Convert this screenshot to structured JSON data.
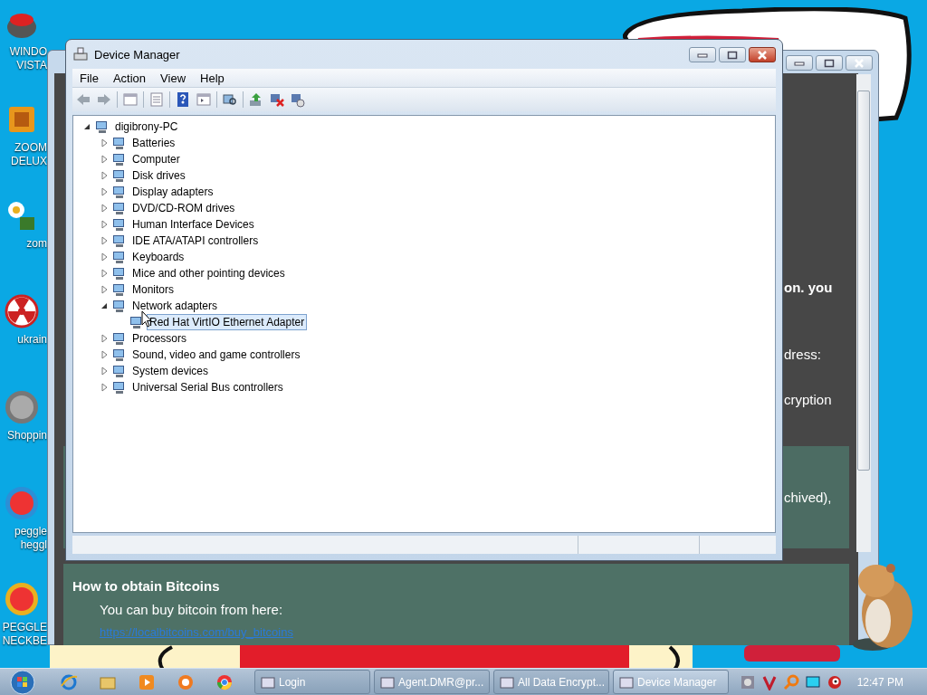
{
  "desktop_icons": [
    {
      "lines": [
        "WINDO",
        "VISTA"
      ]
    },
    {
      "lines": [
        "ZOOM",
        "DELUX"
      ]
    },
    {
      "lines": [
        "zom"
      ]
    },
    {
      "lines": [
        "ukrain"
      ]
    },
    {
      "lines": [
        "Shoppin"
      ]
    },
    {
      "lines": [
        "peggle",
        "heggl"
      ]
    },
    {
      "lines": [
        "PEGGLE",
        "NECKBE"
      ]
    }
  ],
  "background_window": {
    "fragments": [
      {
        "text": "on. you",
        "bold": true
      },
      {
        "text": "dress:",
        "bold": false
      },
      {
        "text": "cryption",
        "bold": false
      }
    ],
    "panel_text": "chived),",
    "bitcoin_section": {
      "heading": "How to obtain Bitcoins",
      "text": "You can buy bitcoin from here:",
      "link": "https://localbitcoins.com/buy_bitcoins"
    }
  },
  "device_manager": {
    "title": "Device Manager",
    "menu": [
      "File",
      "Action",
      "View",
      "Help"
    ],
    "tree": {
      "label": "digibrony-PC",
      "expanded": true,
      "selected": false,
      "children": [
        {
          "label": "Batteries",
          "expanded": false,
          "selected": false
        },
        {
          "label": "Computer",
          "expanded": false,
          "selected": false
        },
        {
          "label": "Disk drives",
          "expanded": false,
          "selected": false
        },
        {
          "label": "Display adapters",
          "expanded": false,
          "selected": false
        },
        {
          "label": "DVD/CD-ROM drives",
          "expanded": false,
          "selected": false
        },
        {
          "label": "Human Interface Devices",
          "expanded": false,
          "selected": false
        },
        {
          "label": "IDE ATA/ATAPI controllers",
          "expanded": false,
          "selected": false
        },
        {
          "label": "Keyboards",
          "expanded": false,
          "selected": false
        },
        {
          "label": "Mice and other pointing devices",
          "expanded": false,
          "selected": false
        },
        {
          "label": "Monitors",
          "expanded": false,
          "selected": false
        },
        {
          "label": "Network adapters",
          "expanded": true,
          "selected": false,
          "children": [
            {
              "label": "Red Hat VirtIO Ethernet Adapter",
              "selected": true
            }
          ]
        },
        {
          "label": "Processors",
          "expanded": false,
          "selected": false
        },
        {
          "label": "Sound, video and game controllers",
          "expanded": false,
          "selected": false
        },
        {
          "label": "System devices",
          "expanded": false,
          "selected": false
        },
        {
          "label": "Universal Serial Bus controllers",
          "expanded": false,
          "selected": false
        }
      ]
    }
  },
  "taskbar": {
    "tasks": [
      {
        "label": "Login",
        "selected": false
      },
      {
        "label": "Agent.DMR@pr...",
        "selected": false
      },
      {
        "label": "All Data Encrypt...",
        "selected": false
      },
      {
        "label": "Device Manager",
        "selected": true
      }
    ],
    "clock": "12:47 PM"
  }
}
